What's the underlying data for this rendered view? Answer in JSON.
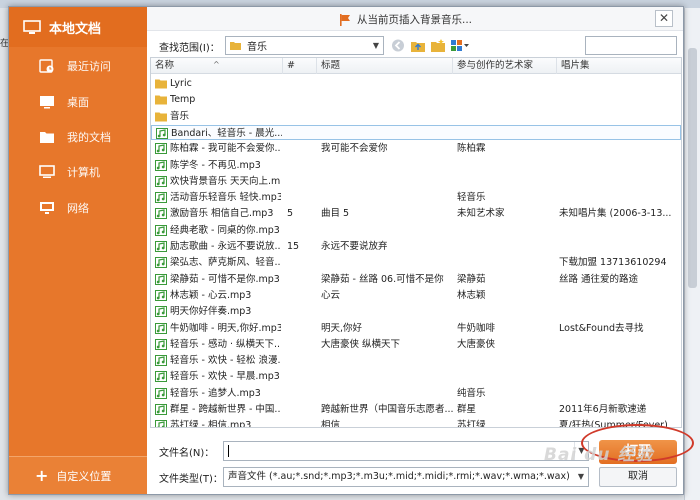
{
  "background": {
    "left_text": "在"
  },
  "sidebar": {
    "title": "本地文档",
    "items": [
      {
        "label": "最近访问",
        "icon": "recent-icon"
      },
      {
        "label": "桌面",
        "icon": "desktop-icon"
      },
      {
        "label": "我的文档",
        "icon": "folder-icon"
      },
      {
        "label": "计算机",
        "icon": "computer-icon"
      },
      {
        "label": "网络",
        "icon": "network-icon"
      }
    ],
    "footer_label": "自定义位置"
  },
  "dialog": {
    "title": "从当前页插入背景音乐...",
    "close_symbol": "✕"
  },
  "lookin": {
    "label": "查找范围(I)：",
    "value": "音乐"
  },
  "columns": {
    "name": "名称",
    "num": "#",
    "title": "标题",
    "artist": "参与创作的艺术家",
    "album": "唱片集"
  },
  "files": [
    {
      "type": "folder",
      "name": "Lyric",
      "num": "",
      "title": "",
      "artist": "",
      "album": ""
    },
    {
      "type": "folder",
      "name": "Temp",
      "num": "",
      "title": "",
      "artist": "",
      "album": ""
    },
    {
      "type": "folder",
      "name": "音乐",
      "num": "",
      "title": "",
      "artist": "",
      "album": ""
    },
    {
      "type": "audio",
      "name": "Bandari、轻音乐 - 晨光...",
      "num": "",
      "title": "",
      "artist": "",
      "album": "",
      "selected": true
    },
    {
      "type": "audio",
      "name": "陈柏霖 - 我可能不会爱你...",
      "num": "",
      "title": "我可能不会爱你",
      "artist": "陈柏霖",
      "album": ""
    },
    {
      "type": "audio",
      "name": "陈学冬 - 不再见.mp3",
      "num": "",
      "title": "",
      "artist": "",
      "album": ""
    },
    {
      "type": "audio",
      "name": "欢快背景音乐 天天向上.m...",
      "num": "",
      "title": "",
      "artist": "",
      "album": ""
    },
    {
      "type": "audio",
      "name": "活动音乐轻音乐 轻快.mp3",
      "num": "",
      "title": "",
      "artist": "轻音乐",
      "album": ""
    },
    {
      "type": "audio",
      "name": "激励音乐 相信自己.mp3",
      "num": "5",
      "title": "曲目 5",
      "artist": "未知艺术家",
      "album": "未知唱片集 (2006-3-13..."
    },
    {
      "type": "audio",
      "name": "经典老歌 - 同桌的你.mp3",
      "num": "",
      "title": "",
      "artist": "",
      "album": ""
    },
    {
      "type": "audio",
      "name": "励志歌曲 - 永远不要说放...",
      "num": "15",
      "title": "永远不要说放弃",
      "artist": "",
      "album": ""
    },
    {
      "type": "audio",
      "name": "梁弘志、萨克斯风、轻音...",
      "num": "",
      "title": "",
      "artist": "",
      "album": "下载加盟 13713610294"
    },
    {
      "type": "audio",
      "name": "梁静茹 - 可惜不是你.mp3",
      "num": "",
      "title": "梁静茹 - 丝路 06.可惜不是你",
      "artist": "梁静茹",
      "album": "丝路 通往爱的路途"
    },
    {
      "type": "audio",
      "name": "林志颖 - 心云.mp3",
      "num": "",
      "title": "心云",
      "artist": "林志颖",
      "album": ""
    },
    {
      "type": "audio",
      "name": "明天你好伴奏.mp3",
      "num": "",
      "title": "",
      "artist": "",
      "album": ""
    },
    {
      "type": "audio",
      "name": "牛奶咖啡 - 明天,你好.mp3",
      "num": "",
      "title": "明天,你好",
      "artist": "牛奶咖啡",
      "album": "Lost&Found去寻找"
    },
    {
      "type": "audio",
      "name": "轻音乐 - 感动 · 纵横天下...",
      "num": "",
      "title": "大唐豪侠 纵横天下",
      "artist": "大唐豪侠",
      "album": ""
    },
    {
      "type": "audio",
      "name": "轻音乐 - 欢快 - 轻松 浪漫...",
      "num": "",
      "title": "",
      "artist": "",
      "album": ""
    },
    {
      "type": "audio",
      "name": "轻音乐 - 欢快 - 早晨.mp3",
      "num": "",
      "title": "",
      "artist": "",
      "album": ""
    },
    {
      "type": "audio",
      "name": "轻音乐 - 追梦人.mp3",
      "num": "",
      "title": "",
      "artist": "纯音乐",
      "album": ""
    },
    {
      "type": "audio",
      "name": "群星 - 跨越新世界 - 中国...",
      "num": "",
      "title": "跨越新世界（中国音乐志愿者...",
      "artist": "群星",
      "album": "2011年6月新歌速递"
    },
    {
      "type": "audio",
      "name": "苏打绿 - 相信.mp3",
      "num": "",
      "title": "相信",
      "artist": "苏打绿",
      "album": "夏/狂热(Summer/Fever)"
    }
  ],
  "filename": {
    "label": "文件名(N)：",
    "value": ""
  },
  "filetype": {
    "label": "文件类型(T)：",
    "value": "声音文件 (*.au;*.snd;*.mp3;*.m3u;*.mid;*.midi;*.rmi;*.wav;*.wma;*.wax)"
  },
  "buttons": {
    "open": "打开",
    "cancel": "取消"
  },
  "watermark": "Bai du 经验",
  "colors": {
    "sidebar": "#e7772b",
    "accent": "#e26e22",
    "highlight_ring": "#d03a2a",
    "audio_icon": "#3a9a3a",
    "folder_icon": "#e8b33a"
  }
}
